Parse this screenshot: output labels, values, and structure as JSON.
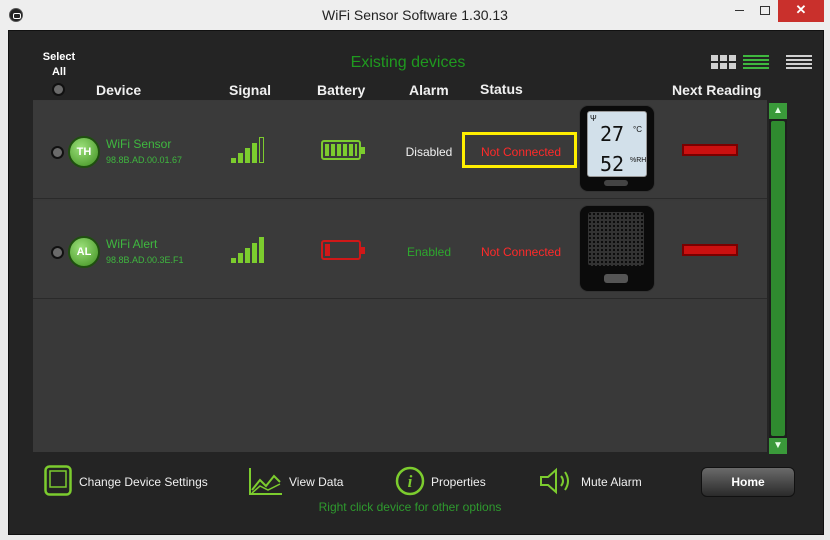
{
  "window": {
    "title": "WiFi Sensor Software 1.30.13"
  },
  "header": {
    "select_all_line1": "Select",
    "select_all_line2": "All",
    "existing_devices": "Existing devices",
    "columns": {
      "device": "Device",
      "signal": "Signal",
      "battery": "Battery",
      "alarm": "Alarm",
      "status": "Status",
      "next_reading": "Next Reading"
    }
  },
  "devices": [
    {
      "badge": "TH",
      "name": "WiFi Sensor",
      "mac": "98.8B.AD.00.01.67",
      "alarm": "Disabled",
      "status": "Not Connected",
      "lcd_temp": "27",
      "lcd_temp_unit": "°C",
      "lcd_humidity": "52",
      "lcd_humidity_unit": "%RH"
    },
    {
      "badge": "AL",
      "name": "WiFi Alert",
      "mac": "98.8B.AD.00.3E.F1",
      "alarm": "Enabled",
      "status": "Not Connected"
    }
  ],
  "toolbar": {
    "change_settings": "Change Device Settings",
    "view_data": "View Data",
    "properties": "Properties",
    "mute_alarm": "Mute Alarm",
    "home": "Home",
    "hint": "Right click device for other options"
  },
  "colors": {
    "accent_green": "#3fb83f",
    "status_red": "#ff2a2a",
    "highlight_yellow": "#ffee00"
  }
}
